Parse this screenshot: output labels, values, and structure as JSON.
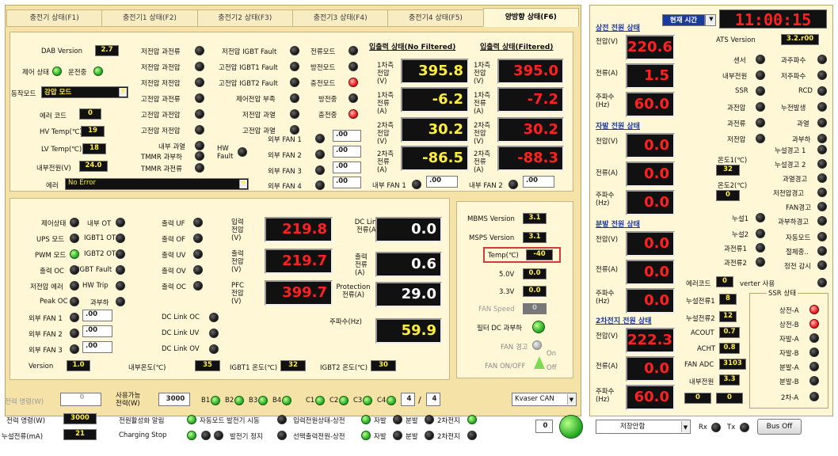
{
  "tabs": [
    "충전기 상태(F1)",
    "충전기1 상태(F2)",
    "충전기2 상태(F3)",
    "충전기3 상태(F4)",
    "충전기4 상태(F5)",
    "양방향 상태(F6)"
  ],
  "top": {
    "dab_version_label": "DAB Version",
    "dab_version": "2.7",
    "control_state_label": "제어 상태",
    "run_label": "운전중",
    "mode_label": "동작모드",
    "mode_value": "강압 모드",
    "error_code_label": "에러 코드",
    "error_code": "0",
    "hv_temp_label": "HV Temp(℃)",
    "hv_temp": "19",
    "lv_temp_label": "LV Temp(℃)",
    "lv_temp": "18",
    "internal_power_label": "내부전원(V)",
    "internal_power": "24.0",
    "error_label": "에러",
    "error_value": "No Error",
    "col1": [
      "저전압 과전류",
      "저전압 과전압",
      "저전압 저전압",
      "고전압 과전류",
      "고전압 과전압",
      "고전압 저전압",
      "내부 과열",
      "TMMR 과부하",
      "TMMR 과전류"
    ],
    "col2": [
      "저전압 IGBT Fault",
      "고전압 IGBT1 Fault",
      "고전압 IGBT2 Fault",
      "제어전압 부족",
      "저전압 과열",
      "고전압 과열"
    ],
    "col3": [
      "전류모드",
      "방전모드",
      "충전모드",
      "방전중",
      "충전중"
    ],
    "hw_fault": "HW Fault",
    "fans": [
      "외부 FAN 1",
      "외부 FAN 2",
      "외부 FAN 3",
      "외부 FAN 4"
    ],
    "fan_val": ".00",
    "io_title_nf": "입출력 상태(No Filtered)",
    "io_title_f": "입출력 상태(Filtered)",
    "io_labels": [
      "1차측 전압(V)",
      "1차측 전류(A)",
      "2차측 전압(V)",
      "2차측 전류(A)"
    ],
    "io_nf": [
      "395.8",
      "-6.2",
      "30.2",
      "-86.5"
    ],
    "io_f": [
      "395.0",
      "-7.2",
      "30.2",
      "-88.3"
    ],
    "int_fan1": "내부 FAN 1",
    "int_fan2": "내부 FAN 2"
  },
  "mid": {
    "col1": [
      "제어상태",
      "UPS 모드",
      "PWM 모드",
      "출력 OC",
      "저전압 에러",
      "Peak OC",
      "외부 FAN 1",
      "외부 FAN 2",
      "외부 FAN 3",
      "Version"
    ],
    "col2": [
      "내부 OT",
      "IGBT1 OT",
      "IGBT2 OT",
      "IGBT Fault",
      "HW Trip",
      "과부하"
    ],
    "col3": [
      "출력 UF",
      "출력 OF",
      "출력 UV",
      "출력 OV",
      "출력 OC"
    ],
    "dc_flags": [
      "DC Link OC",
      "DC Link UV",
      "DC Link OV"
    ],
    "fan_val": ".00",
    "version": "1.0",
    "in_v_label": "입력 전압(V)",
    "in_v": "219.8",
    "out_v_label": "출력 전압(V)",
    "out_v": "219.7",
    "pfc_v_label": "PFC 전압(V)",
    "pfc_v": "399.7",
    "dc_i_label": "DC Link 전류(A)",
    "dc_i": "0.0",
    "out_i_label": "출력 전류(A)",
    "out_i": "0.6",
    "prot_label": "Protection 전류(A)",
    "prot": "29.0",
    "freq_label": "주파수(Hz)",
    "freq": "59.9",
    "temp_int_label": "내부온도(℃)",
    "temp_int": "35",
    "temp_igbt1_label": "IGBT1 온도(℃)",
    "temp_igbt1": "32",
    "temp_igbt2_label": "IGBT2 온도(℃)",
    "temp_igbt2": "30"
  },
  "mbms": {
    "mbms_label": "MBMS Version",
    "mbms": "3.1",
    "msps_label": "MSPS Version",
    "msps": "3.1",
    "temp_label": "Temp(℃)",
    "temp": "-40",
    "v5_label": "5.0V",
    "v5": "0.0",
    "v33_label": "3.3V",
    "v33": "0.0",
    "fan_speed_label": "FAN Speed",
    "fan_speed": "0",
    "filter_label": "필터 DC 과부하",
    "fan_warn_label": "FAN 경고",
    "on_label": "On",
    "fan_onoff_label": "FAN ON/OFF",
    "off_label": "Off"
  },
  "bottom": {
    "power_cmd_label": "전력 명령(W)",
    "power_cmd": "0",
    "avail_label": "사용가능 전력(W)",
    "avail": "3000",
    "batts": [
      "B1",
      "B2",
      "B3",
      "B4"
    ],
    "cells": [
      "C1",
      "C2",
      "C3",
      "C4"
    ],
    "count_a": "4",
    "count_b": "4",
    "can_label": "Kvaser CAN",
    "power_cmd2_label": "전력 명령(W)",
    "power_cmd2": "3000",
    "leak_label": "누설전류(mA)",
    "leak": "21",
    "alarm_label": "전원활성화 알림",
    "auto_label": "자동모드 발전기 시동",
    "stop_label": "Charging Stop",
    "gen_stop_label": "발전기 정지",
    "in_state_label": "입력전원상태-상전",
    "out_sel_label": "선택출력전원-상전",
    "ja": "자발",
    "bun": "분발",
    "cha2": "2차전지",
    "zero": "0"
  },
  "right": {
    "time_label": "현재 시간",
    "time": "11:00:15",
    "ats_label": "ATS Version",
    "ats": "3.2.r00",
    "sangjeon_title": "상전 전원 상태",
    "jabal_title": "자발 전원 상태",
    "bunbal_title": "분발 전원 상태",
    "cha2_title": "2차전지 전원 상태",
    "v_label": "전압(V)",
    "a_label": "전류(A)",
    "hz_label": "주파수 (Hz)",
    "sang": [
      "220.6",
      "1.5",
      "60.0"
    ],
    "ja": [
      "0.0",
      "0.0",
      "0.0"
    ],
    "bun": [
      "0.0",
      "0.0",
      "0.0"
    ],
    "cha2": [
      "222.3",
      "0.0",
      "60.0"
    ],
    "flags_l": [
      "센서",
      "내부전원",
      "SSR",
      "과전압",
      "과전류",
      "저전압"
    ],
    "flags_r": [
      "과주파수",
      "저주파수",
      "RCD",
      "누전발생",
      "과열",
      "과부하"
    ],
    "temp1_label": "온도1(℃)",
    "temp1": "32",
    "temp2_label": "온도2(℃)",
    "temp2": "0",
    "warn": [
      "누설경고 1",
      "누설경고 2",
      "과열경고",
      "저전압경고",
      "FAN경고",
      "과부하경고"
    ],
    "leak": [
      "누설1",
      "누설2",
      "과전류1",
      "과전류2"
    ],
    "auto_label": "자동모드",
    "pre_label": "절체중..",
    "outage_label": "정전 감시",
    "errcode_label": "에러코드",
    "errcode": "0",
    "inverter_label": "verter 사용",
    "leakcur1_label": "누설전류1",
    "leakcur1": "8",
    "leakcur2_label": "누설전류2",
    "leakcur2": "12",
    "acout_label": "ACOUT",
    "acout": "0.7",
    "acht_label": "ACHT",
    "acht": "0.8",
    "fanadc_label": "FAN ADC",
    "fanadc": "3103",
    "intpow_label": "내부전원",
    "intpow": "3.3",
    "z1": "0",
    "z2": "0",
    "ssr_title": "SSR 상태",
    "ssr": [
      "상전-A",
      "상전-B",
      "자발-A",
      "자발-B",
      "분발-A",
      "분발-B",
      "2차-A"
    ],
    "save_label": "저장안함",
    "rx": "Rx",
    "tx": "Tx",
    "busoff": "Bus Off"
  }
}
